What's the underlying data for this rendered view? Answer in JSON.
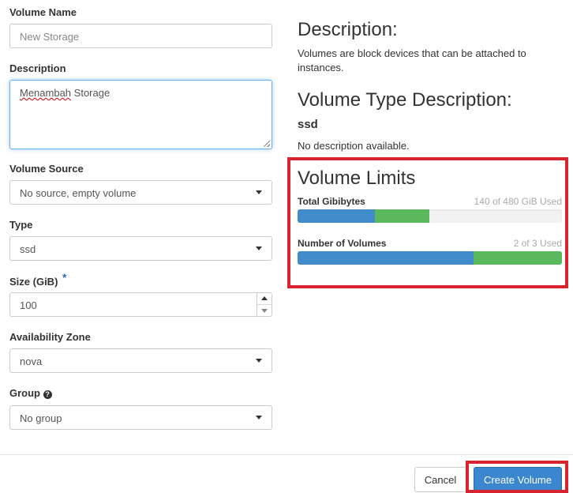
{
  "form": {
    "volume_name": {
      "label": "Volume Name",
      "placeholder": "New Storage"
    },
    "description": {
      "label": "Description",
      "value_word1": "Menambah",
      "value_word2": " Storage"
    },
    "volume_source": {
      "label": "Volume Source",
      "value": "No source, empty volume"
    },
    "type": {
      "label": "Type",
      "value": "ssd"
    },
    "size": {
      "label": "Size (GiB)",
      "required_marker": "*",
      "value": "100"
    },
    "availability_zone": {
      "label": "Availability Zone",
      "value": "nova"
    },
    "group": {
      "label": "Group",
      "help_icon": "?",
      "value": "No group"
    }
  },
  "info": {
    "description_heading": "Description:",
    "description_text": "Volumes are block devices that can be attached to instances.",
    "volume_type_heading": "Volume Type Description:",
    "volume_type_name": "ssd",
    "volume_type_text": "No description available."
  },
  "limits": {
    "heading": "Volume Limits",
    "total_gibibytes": {
      "label": "Total Gibibytes",
      "used_text": "140 of 480 GiB Used",
      "used": 140,
      "requested": 100,
      "max": 480
    },
    "number_of_volumes": {
      "label": "Number of Volumes",
      "used_text": "2 of 3 Used",
      "used": 2,
      "requested": 1,
      "max": 3
    }
  },
  "footer": {
    "cancel_label": "Cancel",
    "create_label": "Create Volume"
  },
  "colors": {
    "used_bar": "#428bca",
    "requested_bar": "#5cb85c",
    "highlight": "#d9232e",
    "primary_button": "#3a87cf"
  }
}
